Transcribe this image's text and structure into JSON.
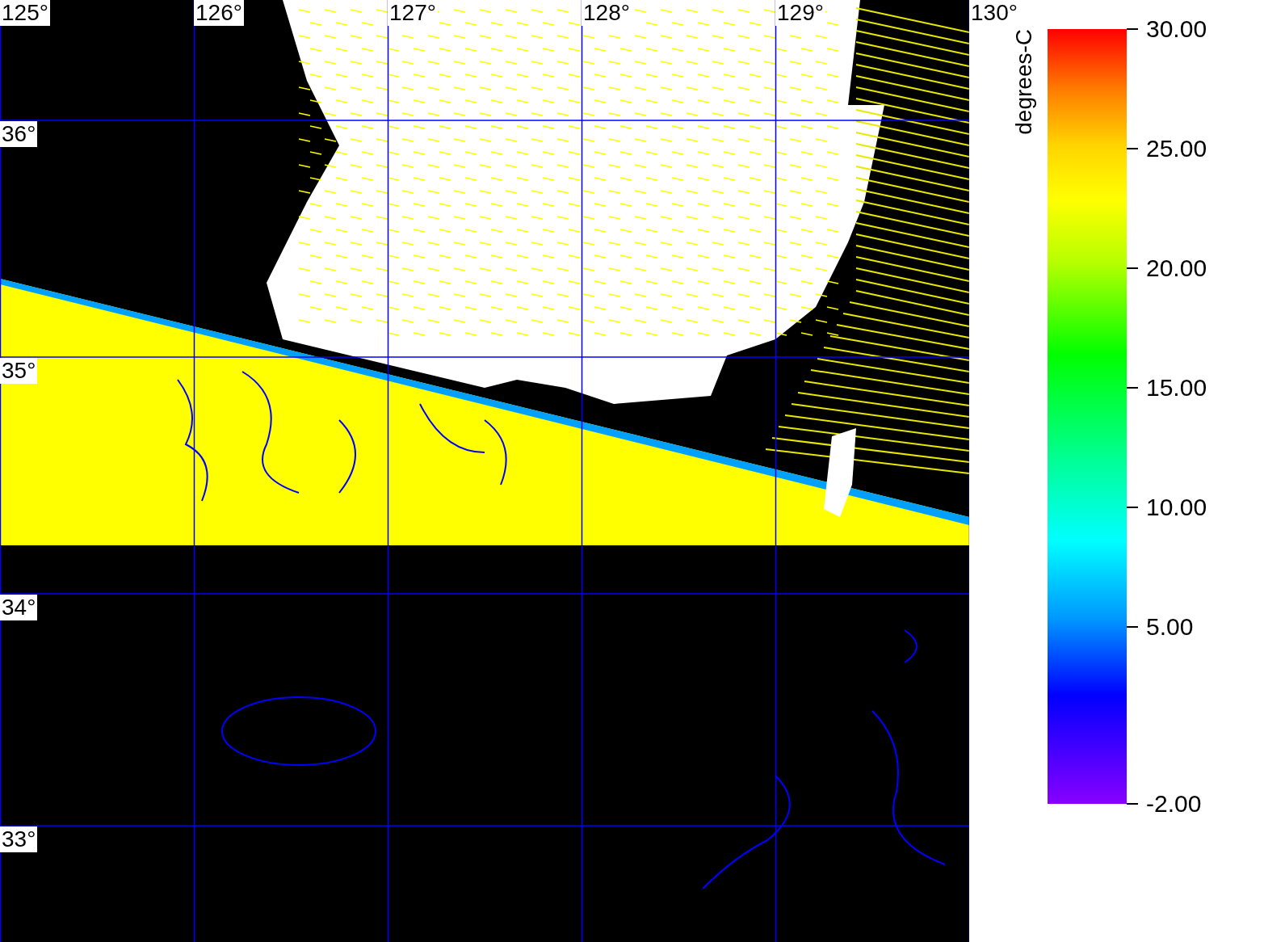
{
  "map": {
    "lon_labels": [
      "125°",
      "126°",
      "127°",
      "128°",
      "129°",
      "130°"
    ],
    "lat_labels": [
      "36°",
      "35°",
      "34°",
      "33°"
    ]
  },
  "colorbar": {
    "unit": "degrees-C",
    "tick_labels": [
      "30.00",
      "25.00",
      "20.00",
      "15.00",
      "10.00",
      "5.00",
      "-2.00"
    ]
  }
}
